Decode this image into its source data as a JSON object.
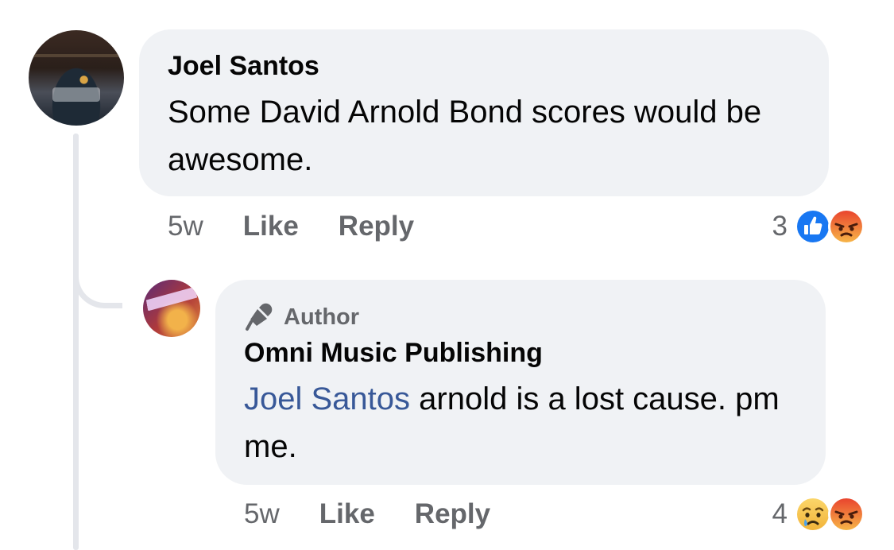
{
  "comments": [
    {
      "author": "Joel Santos",
      "text": "Some David Arnold Bond scores would be awesome.",
      "time": "5w",
      "like_label": "Like",
      "reply_label": "Reply",
      "reaction_count": "3",
      "reactions": [
        "like-icon",
        "angry-icon"
      ]
    }
  ],
  "reply": {
    "badge": "Author",
    "badge_icon": "microphone-icon",
    "author": "Omni Music Publishing",
    "mention": "Joel Santos",
    "text": " arnold is a lost cause. pm me.",
    "time": "5w",
    "like_label": "Like",
    "reply_label": "Reply",
    "reaction_count": "4",
    "reactions": [
      "sad-icon",
      "angry-icon"
    ]
  },
  "colors": {
    "bubble": "#f0f2f5",
    "secondary_text": "#65676b",
    "mention": "#385898",
    "like_blue": "#1877f2",
    "angry_orange": "#f0743a"
  }
}
